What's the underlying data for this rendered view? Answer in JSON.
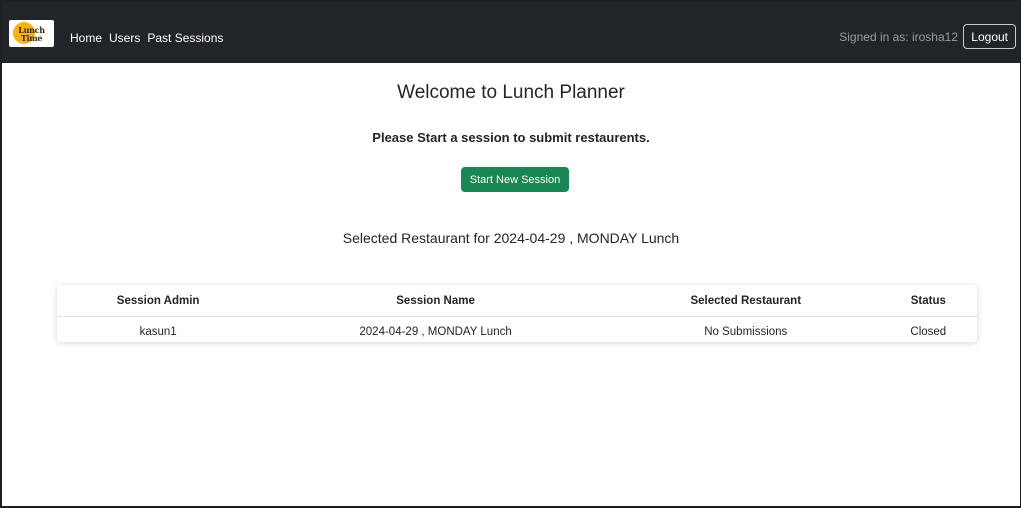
{
  "brand": {
    "logo_text_top": "Lunch",
    "logo_text_bottom": "Time",
    "logo_accent_color": "#f4b41a"
  },
  "nav": {
    "links": [
      {
        "label": "Home"
      },
      {
        "label": "Users"
      },
      {
        "label": "Past Sessions"
      }
    ],
    "signed_in_prefix": "Signed in as: ",
    "username": "irosha12",
    "logout_label": "Logout",
    "background_color": "#212529"
  },
  "main": {
    "title": "Welcome to Lunch Planner",
    "subtitle": "Please Start a session to submit restaurents.",
    "start_button_label": "Start New Session",
    "start_button_color": "#198754",
    "selected_heading": "Selected Restaurant for 2024-04-29 , MONDAY Lunch"
  },
  "table": {
    "headers": [
      "Session Admin",
      "Session Name",
      "Selected Restaurant",
      "Status"
    ],
    "rows": [
      [
        "kasun1",
        "2024-04-29 , MONDAY Lunch",
        "No Submissions",
        "Closed"
      ]
    ]
  }
}
